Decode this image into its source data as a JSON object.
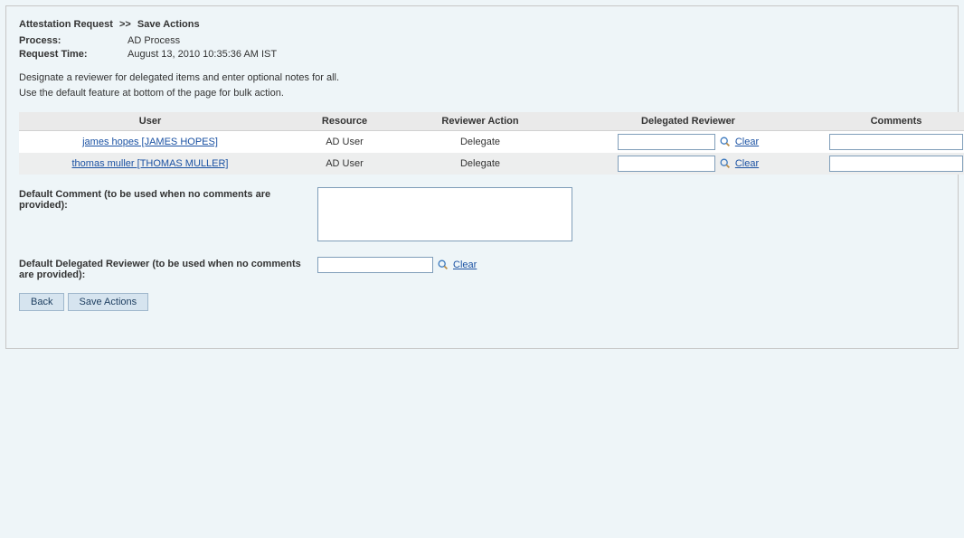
{
  "breadcrumb": {
    "part1": "Attestation Request",
    "sep": ">>",
    "part2": "Save Actions"
  },
  "meta": {
    "process_label": "Process:",
    "process_value": "AD Process",
    "time_label": "Request Time:",
    "time_value": "August 13, 2010 10:35:36 AM IST"
  },
  "instructions_line1": "Designate a reviewer for delegated items and enter optional notes for all.",
  "instructions_line2": "Use the default feature at bottom of the page for bulk action.",
  "columns": {
    "user": "User",
    "resource": "Resource",
    "action": "Reviewer Action",
    "reviewer": "Delegated Reviewer",
    "comments": "Comments"
  },
  "rows": [
    {
      "user": "james hopes [JAMES HOPES]",
      "resource": "AD User",
      "action": "Delegate",
      "reviewer_value": "",
      "clear_label": "Clear",
      "comment_value": ""
    },
    {
      "user": "thomas muller [THOMAS MULLER]",
      "resource": "AD User",
      "action": "Delegate",
      "reviewer_value": "",
      "clear_label": "Clear",
      "comment_value": ""
    }
  ],
  "defaults": {
    "comment_label": "Default Comment (to be used when no comments are provided):",
    "comment_value": "",
    "reviewer_label": "Default Delegated Reviewer (to be used when no comments are provided):",
    "reviewer_value": "",
    "clear_label": "Clear"
  },
  "buttons": {
    "back": "Back",
    "save": "Save Actions"
  }
}
